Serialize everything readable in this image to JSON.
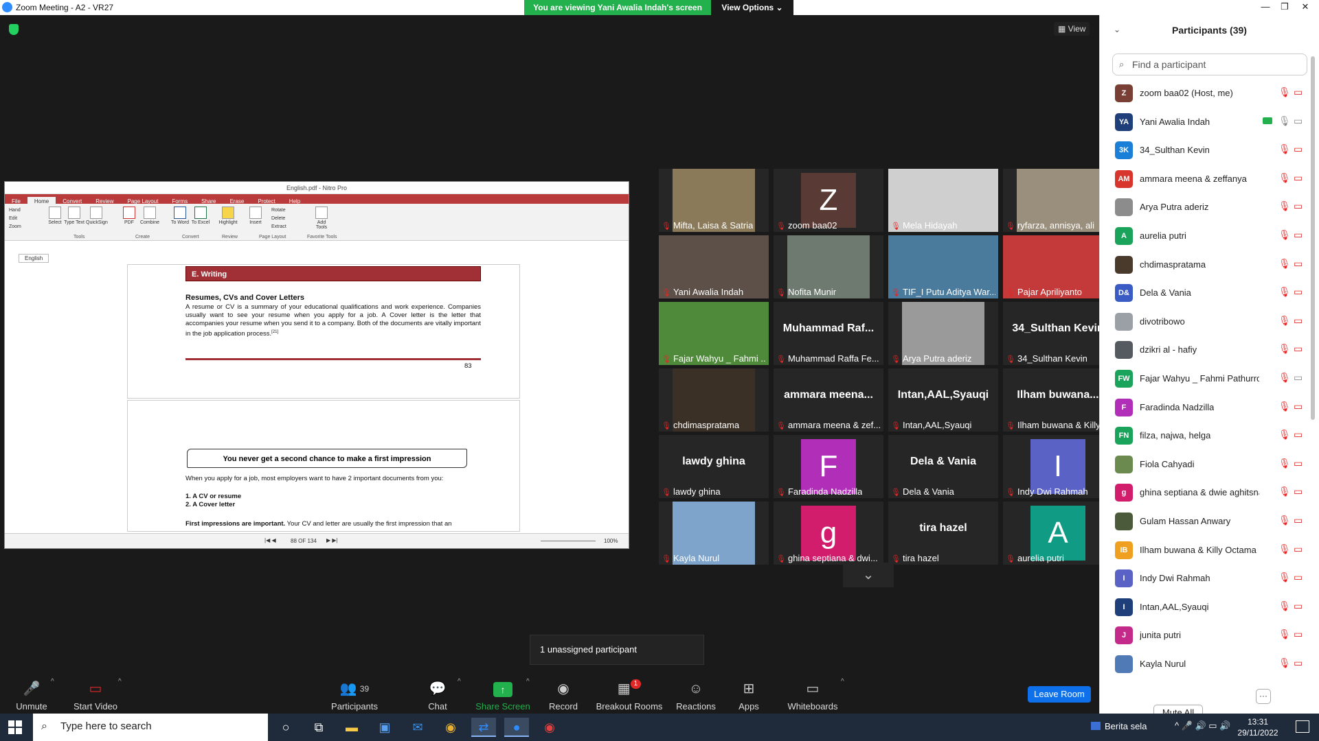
{
  "window": {
    "title": "Zoom Meeting - A2 - VR27",
    "banner": "You are viewing Yani Awalia Indah's screen",
    "view_options": "View Options ⌄",
    "view_button": "View",
    "minimize_icon": "—",
    "maximize_icon": "❐",
    "close_icon": "✕"
  },
  "shared_screen": {
    "app_title": "English.pdf - Nitro Pro",
    "tabs": [
      "File",
      "Home",
      "Convert",
      "Review",
      "Page Layout",
      "Forms",
      "Share",
      "Erase",
      "Protect",
      "Help"
    ],
    "side_tools": [
      "Hand",
      "Edit",
      "Zoom"
    ],
    "ribbon": {
      "select": "Select",
      "type_text": "Type Text",
      "quicksign": "QuickSign",
      "pdf": "PDF",
      "combine": "Combine",
      "to_word": "To Word",
      "to_excel": "To Excel",
      "highlight": "Highlight",
      "insert": "Insert",
      "rotate": "Rotate",
      "delete": "Delete",
      "extract": "Extract",
      "add_tools": "Add Tools",
      "groups": [
        "Tools",
        "Create",
        "Convert",
        "Review",
        "Page Layout",
        "Favorite Tools"
      ]
    },
    "doc_tab": "English",
    "page1": {
      "section": "E. Writing",
      "heading": "Resumes, CVs and Cover Letters",
      "body": "A resume or CV is a summary of your educational qualifications and work experience. Companies usually want to see your resume when you apply for a job. A Cover letter is the letter that accompanies your resume when you send it to a company. Both of the documents are vitally important in the job application process.",
      "footnote": "[21]",
      "page_number": "83"
    },
    "page2": {
      "banner": "You never get a second chance to make a first impression",
      "intro": "When you apply for a job, most employers want to have 2 important documents from you:",
      "item1": "1. A CV or resume",
      "item2": "2. A Cover letter",
      "para_bold": "First impressions are important.",
      "para_rest": " Your CV and letter are usually the first impression that an"
    },
    "status": {
      "page_indicator": "88 OF 134",
      "zoom": "100%"
    }
  },
  "grid": {
    "tiles": [
      {
        "name": "Mifta, Laisa & Satria",
        "kind": "photo",
        "color": "#8b7a5a"
      },
      {
        "name": "zoom baa02",
        "kind": "avatar",
        "letter": "Z",
        "color": "#5a3a34"
      },
      {
        "name": "Mela Hidayah",
        "kind": "photo",
        "color": "#cfcfcf",
        "full": true
      },
      {
        "name": "ryfarza, annisya, ali",
        "kind": "photo",
        "color": "#9a8f7c"
      },
      {
        "name": "Yani Awalia Indah",
        "kind": "photo",
        "color": "#5c5048",
        "full": true
      },
      {
        "name": "Nofita Munir",
        "kind": "photo",
        "color": "#6e7a70"
      },
      {
        "name": "TIF_I Putu Aditya War...",
        "kind": "photo",
        "color": "#4a7b9d",
        "active": true,
        "full": true
      },
      {
        "name": "Pajar Apriliyanto",
        "kind": "photo",
        "color": "#c43a3a",
        "full": true
      },
      {
        "name": "Fajar Wahyu _ Fahmi ...",
        "kind": "photo",
        "color": "#4f8a3a",
        "full": true
      },
      {
        "name": "Muhammad Raffa Fe...",
        "kind": "text",
        "big": "Muhammad  Raf..."
      },
      {
        "name": "Arya Putra aderiz",
        "kind": "photo",
        "color": "#9a9a9a"
      },
      {
        "name": "34_Sulthan Kevin",
        "kind": "text",
        "big": "34_Sulthan Kevin"
      },
      {
        "name": "chdimaspratama",
        "kind": "photo",
        "color": "#3a3026"
      },
      {
        "name": "ammara meena & zef...",
        "kind": "text",
        "big": "ammara  meena..."
      },
      {
        "name": "Intan,AAL,Syauqi",
        "kind": "text",
        "big": "Intan,AAL,Syauqi"
      },
      {
        "name": "Ilham buwana & Killy ...",
        "kind": "text",
        "big": "Ilham  buwana..."
      },
      {
        "name": "lawdy ghina",
        "kind": "text",
        "big": "lawdy ghina"
      },
      {
        "name": "Faradinda Nadzilla",
        "kind": "avatar",
        "letter": "F",
        "color": "#b02eb8"
      },
      {
        "name": "Dela & Vania",
        "kind": "text",
        "big": "Dela & Vania"
      },
      {
        "name": "Indy Dwi Rahmah",
        "kind": "avatar",
        "letter": "I",
        "color": "#5b62c6"
      },
      {
        "name": "Kayla Nurul",
        "kind": "photo",
        "color": "#7ea4cc"
      },
      {
        "name": "ghina septiana & dwi...",
        "kind": "avatar",
        "letter": "g",
        "color": "#d11d6b"
      },
      {
        "name": "tira hazel",
        "kind": "text",
        "big": "tira hazel"
      },
      {
        "name": "aurelia putri",
        "kind": "avatar",
        "letter": "A",
        "color": "#0f9b84"
      }
    ],
    "scroll_down": "⌄"
  },
  "unassigned": "1 unassigned participant",
  "toolbar": {
    "unmute": "Unmute",
    "start_video": "Start Video",
    "participants": "Participants",
    "participants_count": "39",
    "chat": "Chat",
    "share_screen": "Share Screen",
    "record": "Record",
    "breakout": "Breakout Rooms",
    "breakout_badge": "1",
    "reactions": "Reactions",
    "apps": "Apps",
    "whiteboards": "Whiteboards",
    "leave": "Leave Room"
  },
  "panel": {
    "title": "Participants (39)",
    "search_placeholder": "Find a participant",
    "mute_all": "Mute All",
    "more": "···",
    "participants": [
      {
        "name": "zoom baa02 (Host, me)",
        "initials": "Z",
        "color": "#7a3f34"
      },
      {
        "name": "Yani Awalia Indah",
        "initials": "YA",
        "color": "#1f3f7a",
        "sharing": true,
        "cam_off_grey": true,
        "mic_on": true
      },
      {
        "name": "34_Sulthan Kevin",
        "initials": "3K",
        "color": "#1a7fd6"
      },
      {
        "name": "ammara meena & zeffanya",
        "initials": "AM",
        "color": "#d8362c"
      },
      {
        "name": "Arya Putra aderiz",
        "initials": "",
        "color": "#8c8c8c"
      },
      {
        "name": "aurelia putri",
        "initials": "A",
        "color": "#1aa35a"
      },
      {
        "name": "chdimaspratama",
        "initials": "",
        "color": "#4a3a2c"
      },
      {
        "name": "Dela & Vania",
        "initials": "D&",
        "color": "#3b5bc4"
      },
      {
        "name": "divotribowo",
        "initials": "",
        "color": "#9aa0a6"
      },
      {
        "name": "dzikri al - hafiy",
        "initials": "",
        "color": "#555a60"
      },
      {
        "name": "Fajar Wahyu _ Fahmi Pathurrobbi",
        "initials": "FW",
        "color": "#1aa35a",
        "cam_off_grey": true
      },
      {
        "name": "Faradinda Nadzilla",
        "initials": "F",
        "color": "#b02eb8"
      },
      {
        "name": "filza, najwa, helga",
        "initials": "FN",
        "color": "#1aa35a"
      },
      {
        "name": "Fiola Cahyadi",
        "initials": "",
        "color": "#6a8a50"
      },
      {
        "name": "ghina septiana & dwie aghitsna",
        "initials": "g",
        "color": "#d11d6b"
      },
      {
        "name": "Gulam Hassan Anwary",
        "initials": "",
        "color": "#4a5a3a"
      },
      {
        "name": "Ilham buwana & Killy Octama K...",
        "initials": "IB",
        "color": "#f0a020"
      },
      {
        "name": "Indy Dwi Rahmah",
        "initials": "I",
        "color": "#5b62c6"
      },
      {
        "name": "Intan,AAL,Syauqi",
        "initials": "I",
        "color": "#1f3f7a"
      },
      {
        "name": "junita putri",
        "initials": "J",
        "color": "#c42a8a"
      },
      {
        "name": "Kayla Nurul",
        "initials": "",
        "color": "#4f7ab5"
      }
    ]
  },
  "taskbar": {
    "search": "Type here to search",
    "news": "Berita sela",
    "time": "13:31",
    "date": "29/11/2022"
  }
}
